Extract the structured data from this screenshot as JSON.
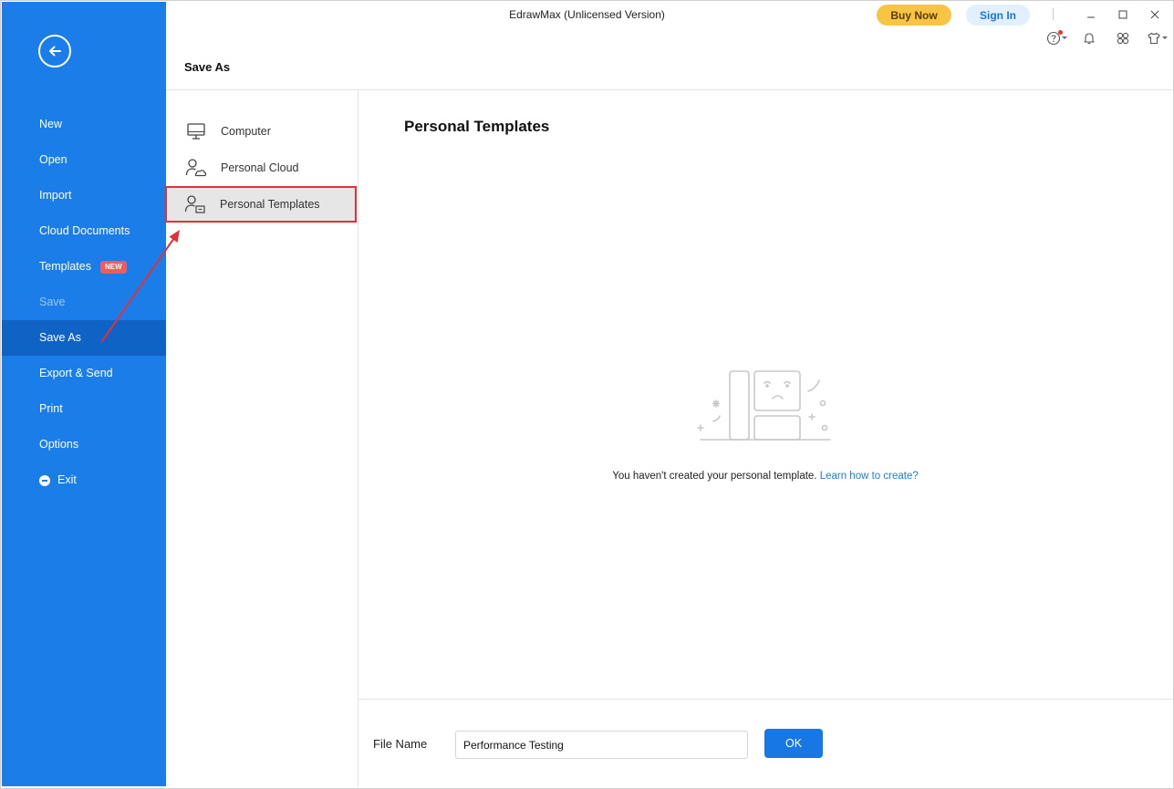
{
  "window": {
    "title": "EdrawMax (Unlicensed Version)"
  },
  "topbar": {
    "buy_label": "Buy Now",
    "sign_label": "Sign In"
  },
  "sidebar": {
    "items": [
      {
        "label": "New"
      },
      {
        "label": "Open"
      },
      {
        "label": "Import"
      },
      {
        "label": "Cloud Documents"
      },
      {
        "label": "Templates",
        "badge": "NEW"
      },
      {
        "label": "Save"
      },
      {
        "label": "Save As"
      },
      {
        "label": "Export & Send"
      },
      {
        "label": "Print"
      },
      {
        "label": "Options"
      },
      {
        "label": "Exit"
      }
    ]
  },
  "page": {
    "title": "Save As"
  },
  "subnav": {
    "items": [
      {
        "label": "Computer"
      },
      {
        "label": "Personal Cloud"
      },
      {
        "label": "Personal Templates"
      }
    ]
  },
  "main": {
    "title": "Personal Templates",
    "empty_message": "You haven't created your personal template.",
    "empty_link": "Learn how to create?"
  },
  "footer": {
    "file_name_label": "File Name",
    "file_name_value": "Performance Testing",
    "ok_label": "OK"
  },
  "colors": {
    "sidebar": "#1b7ee8",
    "sidebar_active": "#0f63c4",
    "accent": "#1677e5",
    "buy": "#f7c543",
    "highlight": "#e0313b",
    "badge": "#f05b5b"
  },
  "icons": [
    "back-arrow-icon",
    "help-icon",
    "bell-icon",
    "apps-icon",
    "theme-shirt-icon",
    "minimize-icon",
    "maximize-icon",
    "close-icon",
    "computer-icon",
    "personal-cloud-icon",
    "personal-template-icon",
    "exit-icon"
  ]
}
